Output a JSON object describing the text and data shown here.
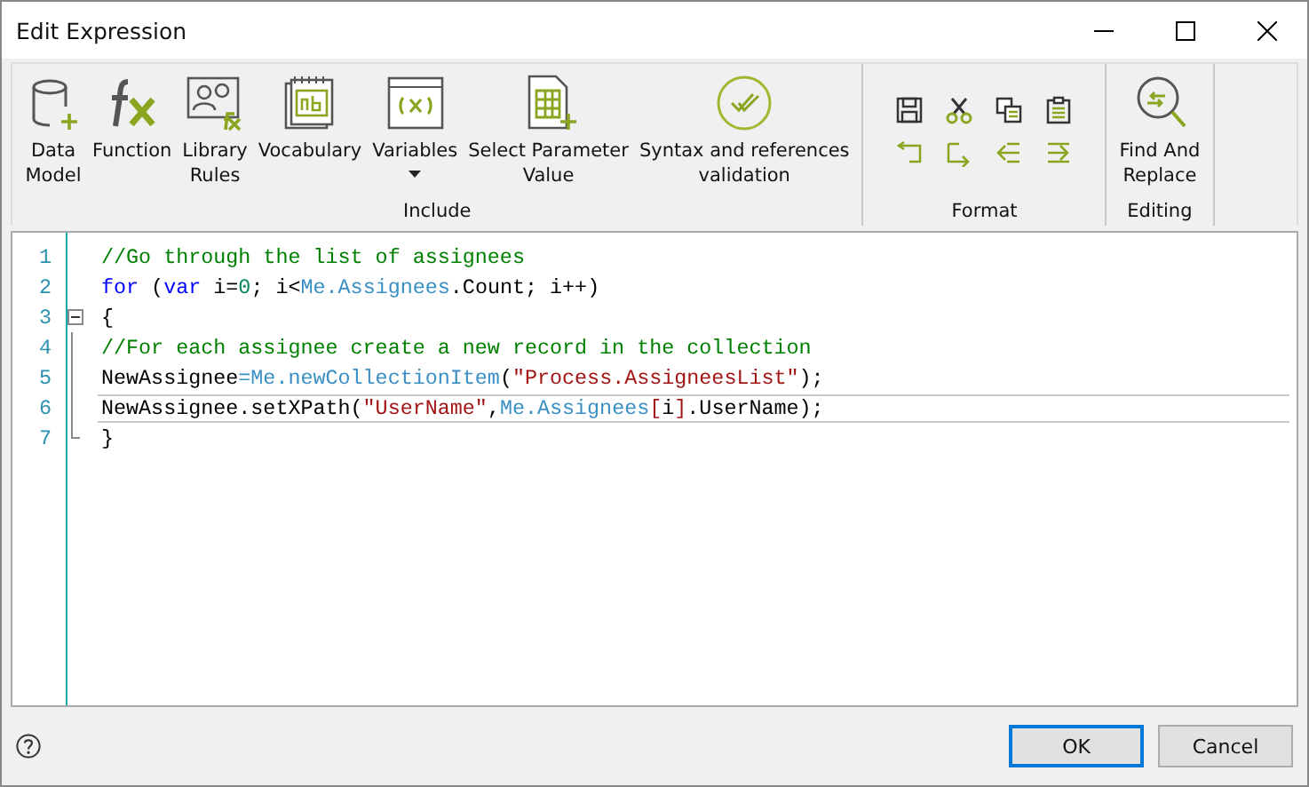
{
  "window": {
    "title": "Edit Expression"
  },
  "ribbon": {
    "groups": [
      {
        "label": "Include",
        "kind": "large",
        "buttons": [
          {
            "lines": [
              "Data",
              "Model"
            ],
            "dropdown": false
          },
          {
            "lines": [
              "Function"
            ],
            "dropdown": false
          },
          {
            "lines": [
              "Library",
              "Rules"
            ],
            "dropdown": false
          },
          {
            "lines": [
              "Vocabulary"
            ],
            "dropdown": false
          },
          {
            "lines": [
              "Variables"
            ],
            "dropdown": true
          },
          {
            "lines": [
              "Select Parameter",
              "Value"
            ],
            "dropdown": false
          },
          {
            "lines": [
              "Syntax and references",
              "validation"
            ],
            "dropdown": false
          }
        ]
      },
      {
        "label": "Format",
        "kind": "small",
        "buttons": [
          {
            "dropdown": false
          },
          {
            "dropdown": false
          },
          {
            "dropdown": false
          },
          {
            "dropdown": false
          },
          {
            "dropdown": false
          },
          {
            "dropdown": false
          },
          {
            "dropdown": false
          },
          {
            "dropdown": false
          }
        ]
      },
      {
        "label": "Editing",
        "kind": "large",
        "buttons": [
          {
            "lines": [
              "Find And",
              "Replace"
            ],
            "dropdown": false
          }
        ]
      }
    ]
  },
  "editor": {
    "lines": [
      {
        "number": "1",
        "current": false,
        "fold_toggle": false,
        "tokens": [
          {
            "kind": "comment",
            "text": "//Go through the list of assignees"
          }
        ]
      },
      {
        "number": "2",
        "current": false,
        "fold_toggle": false,
        "tokens": [
          {
            "kind": "keyword",
            "text": "for"
          },
          {
            "kind": "plain",
            "text": " ("
          },
          {
            "kind": "keyword",
            "text": "var"
          },
          {
            "kind": "plain",
            "text": " i="
          },
          {
            "kind": "number",
            "text": "0"
          },
          {
            "kind": "plain",
            "text": "; i<"
          },
          {
            "kind": "member",
            "text": "Me.Assignees"
          },
          {
            "kind": "plain",
            "text": ".Count; i++)"
          }
        ]
      },
      {
        "number": "3",
        "current": false,
        "fold_toggle": true,
        "expanded": true,
        "tokens": [
          {
            "kind": "plain",
            "text": "{"
          }
        ]
      },
      {
        "number": "4",
        "current": false,
        "fold_toggle": false,
        "tokens": [
          {
            "kind": "comment",
            "text": "//For each assignee create a new record in the collection"
          }
        ]
      },
      {
        "number": "5",
        "current": false,
        "fold_toggle": false,
        "tokens": [
          {
            "kind": "plain",
            "text": "NewAssignee"
          },
          {
            "kind": "member",
            "text": "=Me.newCollectionItem"
          },
          {
            "kind": "plain",
            "text": "("
          },
          {
            "kind": "string",
            "text": "\"Process.AssigneesList\""
          },
          {
            "kind": "plain",
            "text": ");"
          }
        ]
      },
      {
        "number": "6",
        "current": true,
        "fold_toggle": false,
        "tokens": [
          {
            "kind": "plain",
            "text": "NewAssignee.setXPath("
          },
          {
            "kind": "string",
            "text": "\"UserName\""
          },
          {
            "kind": "plain",
            "text": ","
          },
          {
            "kind": "member",
            "text": "Me.Assignees"
          },
          {
            "kind": "string",
            "text": "["
          },
          {
            "kind": "plain",
            "text": "i"
          },
          {
            "kind": "string",
            "text": "]"
          },
          {
            "kind": "plain",
            "text": ".UserName);"
          }
        ]
      },
      {
        "number": "7",
        "current": false,
        "fold_toggle": false,
        "tokens": [
          {
            "kind": "plain",
            "text": "}"
          }
        ]
      }
    ]
  },
  "footer": {
    "buttons": [
      {
        "label": "OK",
        "default": true
      },
      {
        "label": "Cancel",
        "default": false
      }
    ]
  }
}
